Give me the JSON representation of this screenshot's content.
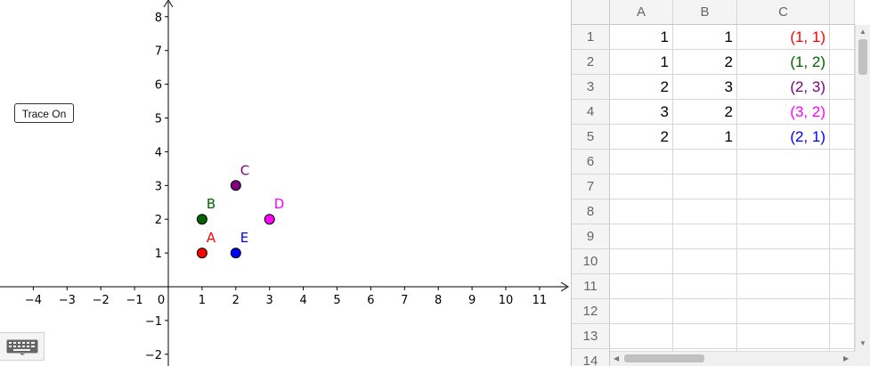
{
  "graphics": {
    "x_ticks": [
      "−4",
      "−3",
      "−2",
      "−1",
      "0",
      "1",
      "2",
      "3",
      "4",
      "5",
      "6",
      "7",
      "8",
      "9",
      "10",
      "11"
    ],
    "x_tick_values": [
      -4,
      -3,
      -2,
      -1,
      0,
      1,
      2,
      3,
      4,
      5,
      6,
      7,
      8,
      9,
      10,
      11
    ],
    "y_ticks": [
      "−2",
      "−1",
      "1",
      "2",
      "3",
      "4",
      "5",
      "6",
      "7",
      "8"
    ],
    "y_tick_values": [
      -2,
      -1,
      1,
      2,
      3,
      4,
      5,
      6,
      7,
      8
    ],
    "points": [
      {
        "label": "A",
        "x": 1,
        "y": 1,
        "color": "#ff0000"
      },
      {
        "label": "B",
        "x": 1,
        "y": 2,
        "color": "#006400"
      },
      {
        "label": "C",
        "x": 2,
        "y": 3,
        "color": "#800080"
      },
      {
        "label": "D",
        "x": 3,
        "y": 2,
        "color": "#ff00ff"
      },
      {
        "label": "E",
        "x": 2,
        "y": 1,
        "color": "#0000ff"
      }
    ],
    "trace_button_label": "Trace On",
    "keyboard_icon": "keyboard-icon"
  },
  "spreadsheet": {
    "columns": [
      "A",
      "B",
      "C"
    ],
    "row_numbers": [
      "1",
      "2",
      "3",
      "4",
      "5",
      "6",
      "7",
      "8",
      "9",
      "10",
      "11",
      "12",
      "13",
      "14"
    ],
    "rows": [
      {
        "a": "1",
        "b": "1",
        "c": "(1, 1)",
        "color": "#ff0000"
      },
      {
        "a": "1",
        "b": "2",
        "c": "(1, 2)",
        "color": "#006400"
      },
      {
        "a": "2",
        "b": "3",
        "c": "(2, 3)",
        "color": "#800080"
      },
      {
        "a": "3",
        "b": "2",
        "c": "(3, 2)",
        "color": "#ff00ff"
      },
      {
        "a": "2",
        "b": "1",
        "c": "(2, 1)",
        "color": "#0000ff"
      }
    ]
  }
}
